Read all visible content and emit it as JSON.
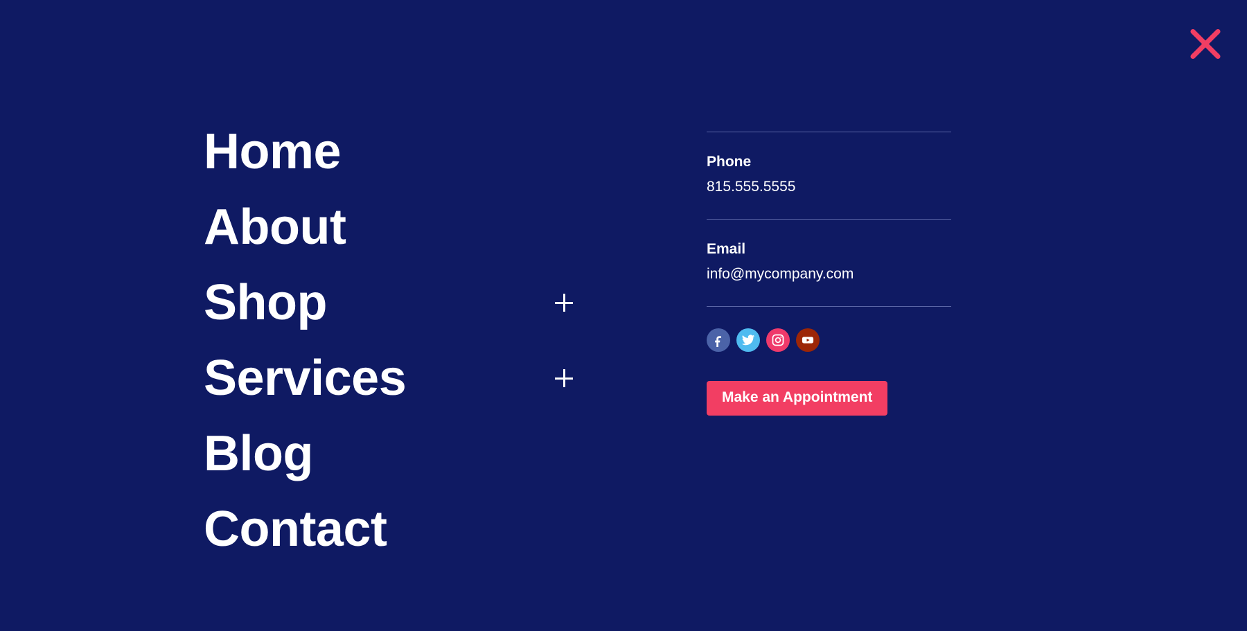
{
  "theme": {
    "background": "#0f1a63",
    "accent": "#f23e63",
    "text": "#ffffff",
    "divider": "#5a65a5"
  },
  "close": {
    "name": "close-menu",
    "label": "Close",
    "color": "#f23e63"
  },
  "nav": {
    "items": [
      {
        "label": "Home",
        "has_submenu": false
      },
      {
        "label": "About",
        "has_submenu": false
      },
      {
        "label": "Shop",
        "has_submenu": true,
        "toggle": "+"
      },
      {
        "label": "Services",
        "has_submenu": true,
        "toggle": "+"
      },
      {
        "label": "Blog",
        "has_submenu": false
      },
      {
        "label": "Contact",
        "has_submenu": false
      }
    ]
  },
  "contact": {
    "phone": {
      "label": "Phone",
      "value": "815.555.5555"
    },
    "email": {
      "label": "Email",
      "value": "info@mycompany.com"
    }
  },
  "social": [
    {
      "name": "facebook",
      "label": "Facebook",
      "color": "#4b63a8"
    },
    {
      "name": "twitter",
      "label": "Twitter",
      "color": "#4fbbf0"
    },
    {
      "name": "instagram",
      "label": "Instagram",
      "color": "#ef3a6b"
    },
    {
      "name": "youtube",
      "label": "YouTube",
      "color": "#9c2607"
    }
  ],
  "cta": {
    "label": "Make an Appointment"
  }
}
